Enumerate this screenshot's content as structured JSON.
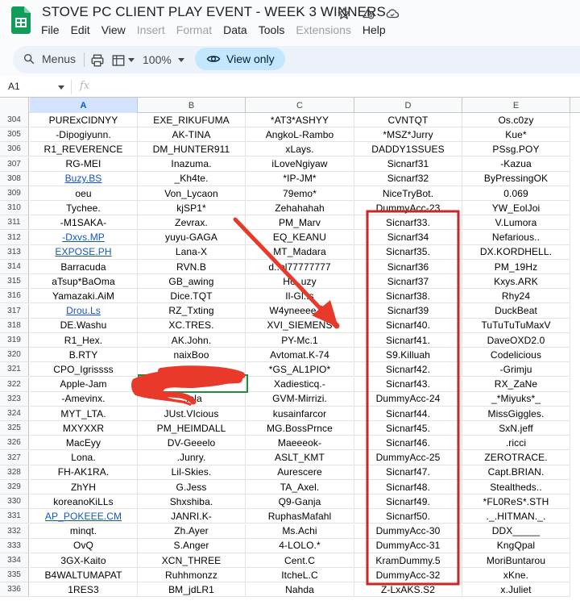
{
  "app": {
    "title": "STOVE PC CLIENT PLAY EVENT - WEEK 3 WINNERS",
    "menu": [
      {
        "label": "File",
        "enabled": true
      },
      {
        "label": "Edit",
        "enabled": true
      },
      {
        "label": "View",
        "enabled": true
      },
      {
        "label": "Insert",
        "enabled": false
      },
      {
        "label": "Format",
        "enabled": false
      },
      {
        "label": "Data",
        "enabled": true
      },
      {
        "label": "Tools",
        "enabled": true
      },
      {
        "label": "Extensions",
        "enabled": false
      },
      {
        "label": "Help",
        "enabled": true
      }
    ]
  },
  "toolbar": {
    "search_label": "Menus",
    "zoom": "100%",
    "view_only_label": "View only"
  },
  "formula_bar": {
    "cell_ref": "A1",
    "fx_label": "fx"
  },
  "sheet": {
    "columns": [
      "A",
      "B",
      "C",
      "D",
      "E"
    ],
    "rows": [
      {
        "n": "304",
        "cells": [
          "PURExCIDNYY",
          "EXE_RIKUFUMA",
          "*AT3*ASHYY",
          "CVNTQT",
          "Os.c0zy"
        ]
      },
      {
        "n": "305",
        "cells": [
          "-Dipogiyunn.",
          "AK-TINA",
          "AngkoL-Rambo",
          "*MSZ*Jurry",
          "Kue*"
        ]
      },
      {
        "n": "306",
        "cells": [
          "R1_REVERENCE",
          "DM_HUNTER911",
          "xLays.",
          "DADDY1SSUES",
          "PSsg.POY"
        ]
      },
      {
        "n": "307",
        "cells": [
          "RG-MEI",
          "Inazuma.",
          "iLoveNgiyaw",
          "Sicnarf31",
          "-Kazua"
        ]
      },
      {
        "n": "308",
        "cells": [
          "Buzy.BS",
          "_Kh4te.",
          "*IP-JM*",
          "Sicnarf32",
          "ByPressingOK"
        ]
      },
      {
        "n": "309",
        "cells": [
          "oeu",
          "Von_Lycaon",
          "79emo*",
          "NiceTryBot.",
          "0.069"
        ]
      },
      {
        "n": "310",
        "cells": [
          "Tychee.",
          "kjSP1*",
          "Zehahahah",
          "DummyAcc-23",
          "YW_EolJoi"
        ]
      },
      {
        "n": "311",
        "cells": [
          "-M1SAKA-",
          "Zevrax.",
          "PM_Marv",
          "Sicnarf33.",
          "V.Lumora"
        ]
      },
      {
        "n": "312",
        "cells": [
          "-Dxvs.MP",
          "yuyu-GAGA",
          "EQ_KEANU",
          "Sicnarf34",
          "Nefarious.."
        ]
      },
      {
        "n": "313",
        "cells": [
          "EXPOSE.PH",
          "Lana-X",
          "MT_Madara",
          "Sicnarf35.",
          "DX.KORDHELL."
        ]
      },
      {
        "n": "314",
        "cells": [
          "Barracuda",
          "RVN.B",
          "d..ol77777777",
          "Sicnarf36",
          "PM_19Hz"
        ]
      },
      {
        "n": "315",
        "cells": [
          "aTsup*BaOma",
          "GB_awing",
          "Ho..uzy",
          "Sicnarf37",
          "Kxys.ARK"
        ]
      },
      {
        "n": "316",
        "cells": [
          "Yamazaki.AiM",
          "Dice.TQT",
          "Il-Gl..s",
          "Sicnarf38.",
          "Rhy24"
        ]
      },
      {
        "n": "317",
        "cells": [
          "Drou.Ls",
          "RZ_Txting",
          "W4yneeee...h",
          "Sicnarf39",
          "DuckBeat"
        ]
      },
      {
        "n": "318",
        "cells": [
          "DE.Washu",
          "XC.TRES.",
          "XVI_SIEMENS",
          "Sicnarf40.",
          "TuTuTuTuMaxV"
        ]
      },
      {
        "n": "319",
        "cells": [
          "R1_Hex.",
          "AK.John.",
          "PY-Mc.1",
          "Sicnarf41.",
          "DaveOXD2.0"
        ]
      },
      {
        "n": "320",
        "cells": [
          "B.RTY",
          "naixBoo",
          "Avtomat.K-74",
          "S9.Killuah",
          "Codelicious"
        ]
      },
      {
        "n": "321",
        "cells": [
          "CPO_Igrissss",
          "xy.K...",
          "*GS_AL1PIO*",
          "Sicnarf42.",
          "-Grimju"
        ]
      },
      {
        "n": "322",
        "cells": [
          "Apple-Jam",
          "",
          "Xadiesticq.-",
          "Sicnarf43.",
          "RX_ZaNe"
        ]
      },
      {
        "n": "323",
        "cells": [
          "-Amevinx.",
          "...ela",
          "GVM-Mirrizi.",
          "DummyAcc-24",
          "_*Miyuks*_"
        ]
      },
      {
        "n": "324",
        "cells": [
          "MYT_LTA.",
          "JUst.VIcious",
          "kusainfarcor",
          "Sicnarf44.",
          "MissGiggles."
        ]
      },
      {
        "n": "325",
        "cells": [
          "MXYXXR",
          "PM_HEIMDALL",
          "MG.BossPrnce",
          "Sicnarf45.",
          "SxN.jeff"
        ]
      },
      {
        "n": "326",
        "cells": [
          "MacEyy",
          "DV-Geeelo",
          "Maeeeok-",
          "Sicnarf46.",
          ".ricci"
        ]
      },
      {
        "n": "327",
        "cells": [
          "Lona.",
          ".Junry.",
          "ASLT_KMT",
          "DummyAcc-25",
          "ZEROTRACE."
        ]
      },
      {
        "n": "328",
        "cells": [
          "FH-AK1RA.",
          "Lil-Skies.",
          "Aurescere",
          "Sicnarf47.",
          "Capt.BRIAN."
        ]
      },
      {
        "n": "329",
        "cells": [
          "ZhYH",
          "G.Jess",
          "TA_Axel.",
          "Sicnarf48.",
          "Stealtheds.."
        ]
      },
      {
        "n": "330",
        "cells": [
          "koreanoKiLLs",
          "Shxshiba.",
          "Q9-Ganja",
          "Sicnarf49.",
          "*FL0ReS*.STH"
        ]
      },
      {
        "n": "331",
        "cells": [
          "AP_POKEEE.CM",
          "JANRI.K-",
          "RuphasMafahl",
          "Sicnarf50.",
          "._.HITMAN._."
        ]
      },
      {
        "n": "332",
        "cells": [
          "minqt.",
          "Zh.Ayer",
          "Ms.Achi",
          "DummyAcc-30",
          "DDX_____"
        ]
      },
      {
        "n": "333",
        "cells": [
          "OvQ",
          "S.Anger",
          "4-LOLO.*",
          "DummyAcc-31",
          "KngQpal"
        ]
      },
      {
        "n": "334",
        "cells": [
          "3GX-Kaito",
          "XCN_THREE",
          "Cent.C",
          "KramDummy.5",
          "MoriBuntarou"
        ]
      },
      {
        "n": "335",
        "cells": [
          "B4WALTUMAPAT",
          "Ruhhmonzz",
          "ItcheL.C",
          "DummyAcc-32",
          "xKne."
        ]
      },
      {
        "n": "336",
        "cells": [
          "1RES3",
          "BM_jdLR1",
          "Nahda",
          "Z-LxAKS.S2",
          "x.Juliet"
        ]
      }
    ],
    "link_cells": [
      "Buzy.BS",
      "-Dxvs.MP",
      "EXPOSE.PH",
      "Drou.Ls",
      "AP_POKEEE.CM"
    ]
  },
  "colors": {
    "annotation_red": "#e8392b",
    "header_selected": "#d3e3fd",
    "view_only_pill": "#c2e7ff",
    "sheets_green": "#0f9d58"
  }
}
